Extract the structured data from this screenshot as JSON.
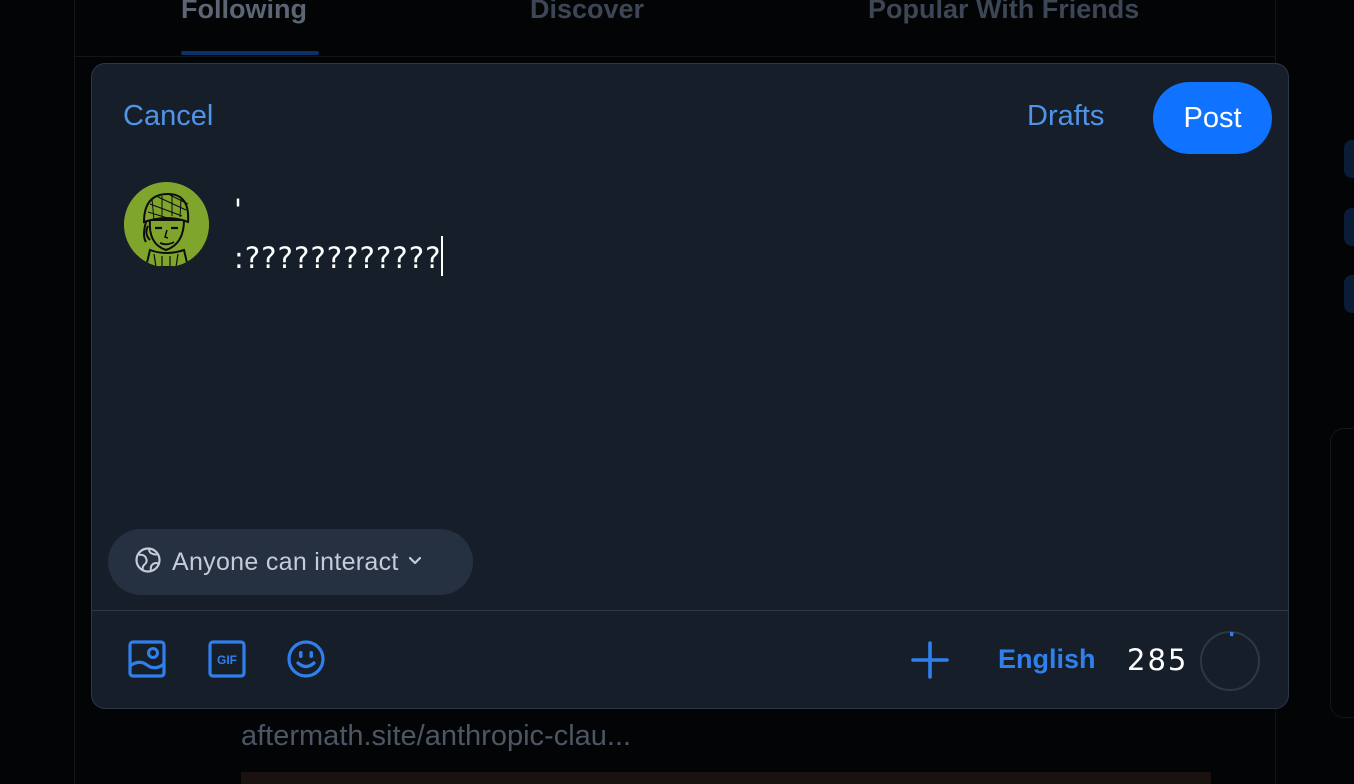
{
  "background": {
    "tabs": [
      "Following",
      "Discover",
      "Popular With Friends"
    ],
    "active_tab": "Following",
    "link_text": "aftermath.site/anthropic-clau..."
  },
  "composer": {
    "cancel_label": "Cancel",
    "drafts_label": "Drafts",
    "post_label": "Post",
    "text_line1": "'",
    "text_line2": ":????????????",
    "interaction_setting": "Anyone can interact",
    "language": "English",
    "chars_remaining": "285",
    "progress_fraction": 0.02
  },
  "colors": {
    "accent": "#0f73ff",
    "link": "#4f94e8",
    "modal_bg": "#161e29",
    "avatar_bg": "#7fa52c"
  },
  "icons": [
    "globe-icon",
    "chevron-down-icon",
    "image-icon",
    "gif-icon",
    "emoji-icon",
    "plus-icon"
  ]
}
